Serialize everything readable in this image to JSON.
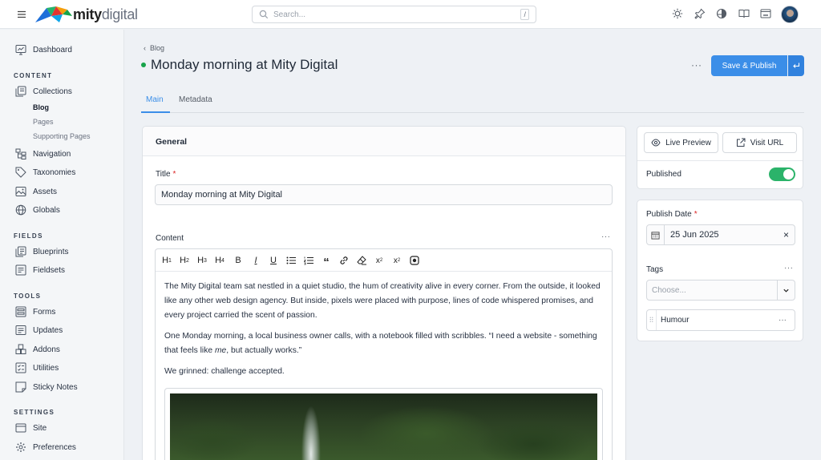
{
  "header": {
    "logo_bold": "mity",
    "logo_light": "digital",
    "search_placeholder": "Search...",
    "search_shortcut": "/",
    "icons": [
      "sun-icon",
      "pin-icon",
      "contrast-icon",
      "book-icon",
      "site-icon"
    ]
  },
  "sidebar": {
    "dashboard": "Dashboard",
    "content_heading": "CONTENT",
    "collections": "Collections",
    "collection_items": [
      "Blog",
      "Pages",
      "Supporting Pages"
    ],
    "navigation": "Navigation",
    "taxonomies": "Taxonomies",
    "assets": "Assets",
    "globals": "Globals",
    "fields_heading": "FIELDS",
    "blueprints": "Blueprints",
    "fieldsets": "Fieldsets",
    "tools_heading": "TOOLS",
    "forms": "Forms",
    "updates": "Updates",
    "addons": "Addons",
    "utilities": "Utilities",
    "sticky_notes": "Sticky Notes",
    "settings_heading": "SETTINGS",
    "site": "Site",
    "preferences": "Preferences"
  },
  "page": {
    "breadcrumb": "Blog",
    "title": "Monday morning at Mity Digital",
    "more": "···",
    "save_publish": "Save & Publish",
    "tabs": [
      "Main",
      "Metadata"
    ]
  },
  "general": {
    "section_title": "General",
    "title_label": "Title",
    "required_mark": "*",
    "title_value": "Monday morning at Mity Digital",
    "content_label": "Content",
    "content_more": "···",
    "toolbar": [
      "H1",
      "H2",
      "H3",
      "H4",
      "B",
      "I",
      "U"
    ],
    "paragraphs": {
      "p1": "The Mity Digital team sat nestled in a quiet studio, the hum of creativity alive in every corner. From the outside, it looked like any other web design agency. But inside, pixels were placed with purpose, lines of code whispered promises, and every project carried the scent of passion.",
      "p2_a": "One Monday morning, a local business owner calls, with a notebook filled with scribbles. “I need a website - something that feels like ",
      "p2_em": "me",
      "p2_b": ", but actually works.”",
      "p3": "We grinned: challenge accepted."
    }
  },
  "sidebar_panel": {
    "live_preview": "Live Preview",
    "visit_url": "Visit URL",
    "published_label": "Published",
    "published": true,
    "publish_date_label": "Publish Date",
    "publish_date": "25 Jun 2025",
    "clear": "×",
    "tags_label": "Tags",
    "tags_more": "···",
    "tags_placeholder": "Choose...",
    "tag_items": [
      "Humour"
    ],
    "tag_more": "···"
  },
  "colors": {
    "accent": "#3b8ee8",
    "published_dot": "#17a34a",
    "toggle_on": "#2bb36a"
  }
}
